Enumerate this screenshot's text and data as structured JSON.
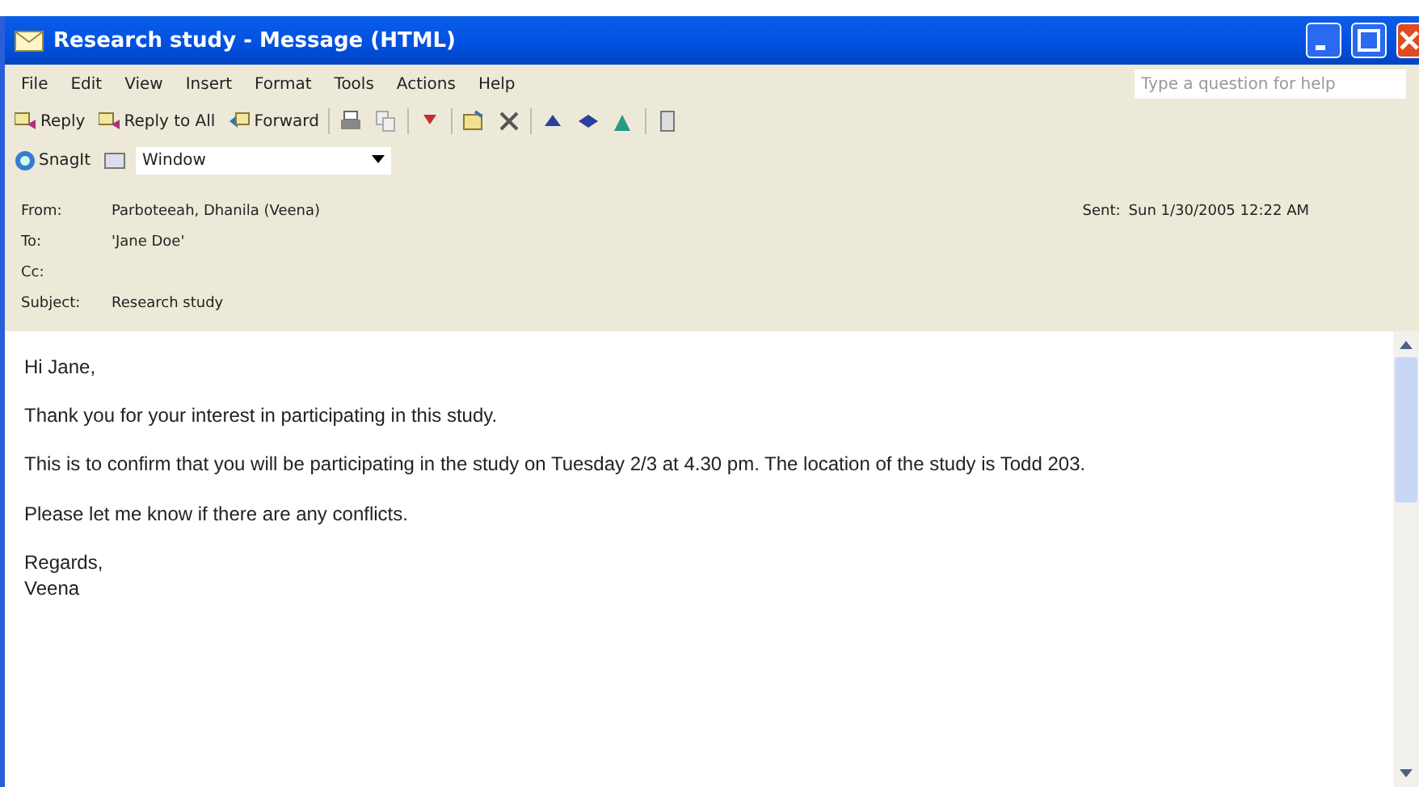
{
  "window": {
    "title": "Research study - Message (HTML)"
  },
  "menu": [
    "File",
    "Edit",
    "View",
    "Insert",
    "Format",
    "Tools",
    "Actions",
    "Help"
  ],
  "help_search": {
    "placeholder": "Type a question for help"
  },
  "toolbar_buttons": [
    "Reply",
    "Reply to All",
    "Forward"
  ],
  "snagit": {
    "label": "SnagIt",
    "combo_value": "Window"
  },
  "header": {
    "fields": [
      {
        "label": "From:",
        "value": "Parboteeah, Dhanila (Veena)"
      },
      {
        "label": "To:",
        "value": "'Jane Doe'"
      },
      {
        "label": "Cc:"
      },
      {
        "label": "Subject:",
        "value": "Research study"
      }
    ],
    "sent_label": "Sent:",
    "sent": "Sun 1/30/2005 12:22 AM"
  },
  "body": [
    "Hi Jane,",
    "Thank you for your interest in participating in this study.",
    "This is to confirm that you will be participating in the study on Tuesday 2/3 at 4.30 pm.  The location of the study is Todd 203.",
    "Please let me know if there are any conflicts.",
    "Regards,\nVeena"
  ]
}
